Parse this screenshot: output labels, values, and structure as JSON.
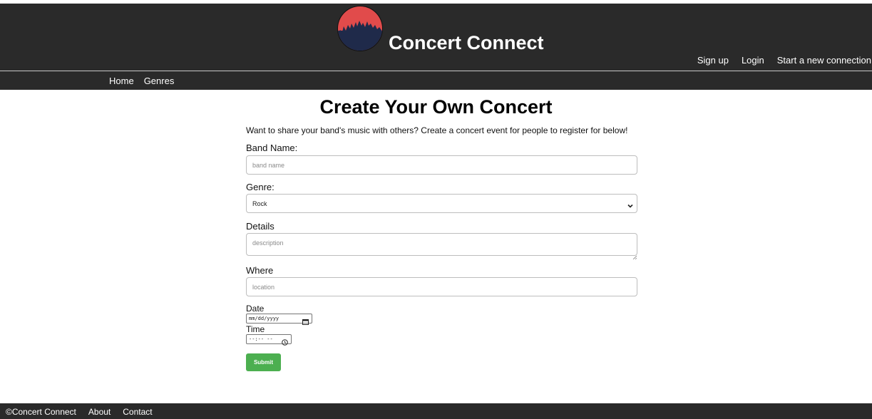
{
  "header": {
    "brand": "Concert Connect",
    "links": [
      "Sign up",
      "Login",
      "Start a new connection"
    ]
  },
  "nav": {
    "items": [
      "Home",
      "Genres"
    ]
  },
  "main": {
    "title": "Create Your Own Concert",
    "intro": "Want to share your band's music with others? Create a concert event for people to register for below!",
    "band_name": {
      "label": "Band Name:",
      "placeholder": "band name",
      "value": ""
    },
    "genre": {
      "label": "Genre:",
      "selected": "Rock"
    },
    "details": {
      "label": "Details",
      "placeholder": "description",
      "value": ""
    },
    "where": {
      "label": "Where",
      "placeholder": "location",
      "value": ""
    },
    "date": {
      "label": "Date",
      "value": "mm/dd/yyyy"
    },
    "time": {
      "label": "Time",
      "value": "--:-- --"
    },
    "submit_label": "Submit"
  },
  "footer": {
    "copyright": "©Concert Connect",
    "links": [
      "About",
      "Contact"
    ]
  },
  "colors": {
    "bar": "#2a2a2a",
    "submit": "#4caf50",
    "logo_red": "#e14b4b",
    "logo_navy": "#1f2a4a"
  },
  "icons": [
    "concert-crowd-logo-icon",
    "chevron-down-icon",
    "calendar-icon",
    "clock-icon",
    "resize-grip-icon"
  ]
}
